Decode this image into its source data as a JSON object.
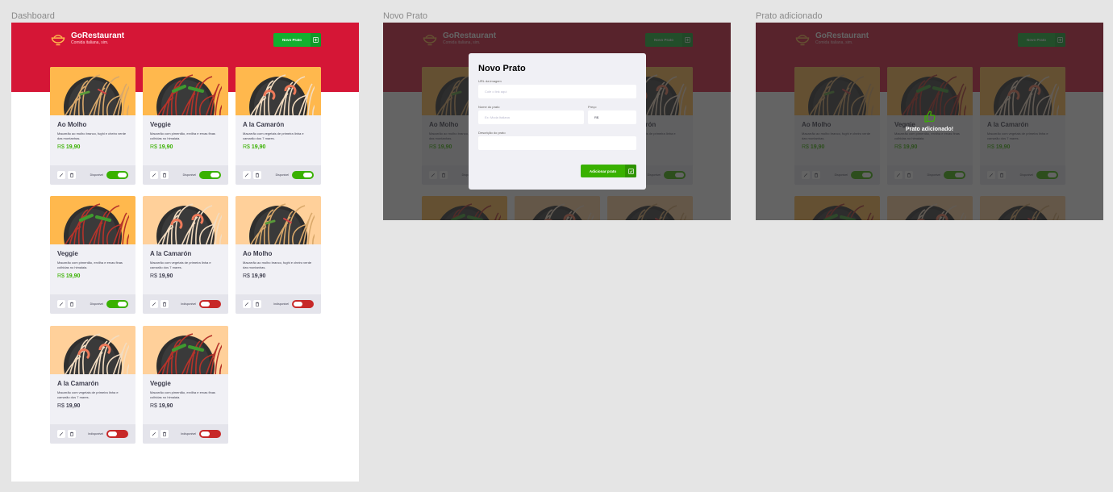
{
  "frames": {
    "dashboard": "Dashboard",
    "novo_prato": "Novo Prato",
    "adicionado": "Prato adicionado"
  },
  "app": {
    "title": "GoRestaurant",
    "subtitle": "Comida italiana, sim.",
    "new_button": "Novo Prato"
  },
  "colors": {
    "brand_red": "#d51636",
    "accent_green": "#39b100",
    "off_red": "#c72828"
  },
  "dishes": [
    {
      "name": "Ao Molho",
      "desc": "Macarrão ao molho branco, fughi e cheiro verde das montanhas.",
      "currency": "R$",
      "price": "19,90",
      "available_label": "Disponível",
      "available": true,
      "dish": "sauce"
    },
    {
      "name": "Veggie",
      "desc": "Macarrão com pimentão, ervilha e ervas finas colhidas no himalaia.",
      "currency": "R$",
      "price": "19,90",
      "available_label": "Disponível",
      "available": true,
      "dish": "veggie"
    },
    {
      "name": "A la Camarón",
      "desc": "Macarrão com vegetais de primeira linha e camarão dos 7 mares.",
      "currency": "R$",
      "price": "19,90",
      "available_label": "Disponível",
      "available": true,
      "dish": "shrimp"
    },
    {
      "name": "Veggie",
      "desc": "Macarrão com pimentão, ervilha e ervas finas colhidas no himalaia.",
      "currency": "R$",
      "price": "19,90",
      "available_label": "Disponível",
      "available": true,
      "dish": "veggie"
    },
    {
      "name": "A la Camarón",
      "desc": "Macarrão com vegetais de primeira linha e camarão dos 7 mares.",
      "currency": "R$",
      "price": "19,90",
      "available_label": "Indisponível",
      "available": false,
      "dish": "shrimp"
    },
    {
      "name": "Ao Molho",
      "desc": "Macarrão ao molho branco, fughi e cheiro verde das montanhas.",
      "currency": "R$",
      "price": "19,90",
      "available_label": "Indisponível",
      "available": false,
      "dish": "sauce"
    },
    {
      "name": "A la Camarón",
      "desc": "Macarrão com vegetais de primeira linha e camarão dos 7 mares.",
      "currency": "R$",
      "price": "19,90",
      "available_label": "Indisponível",
      "available": false,
      "dish": "shrimp"
    },
    {
      "name": "Veggie",
      "desc": "Macarrão com pimentão, ervilha e ervas finas colhidas no himalaia.",
      "currency": "R$",
      "price": "19,90",
      "available_label": "Indisponível",
      "available": false,
      "dish": "veggie"
    }
  ],
  "modal": {
    "title": "Novo Prato",
    "url_label": "URL da imagem",
    "url_placeholder": "Cole o link aqui",
    "name_label": "Nome do prato",
    "name_placeholder": "Ex: Moda Italiana",
    "price_label": "Preço",
    "price_value": "R$",
    "desc_label": "Descrição do prato",
    "submit": "Adicionar prato"
  },
  "toast": {
    "message": "Prato adicionado!",
    "icon": "thumbs-up-icon"
  }
}
